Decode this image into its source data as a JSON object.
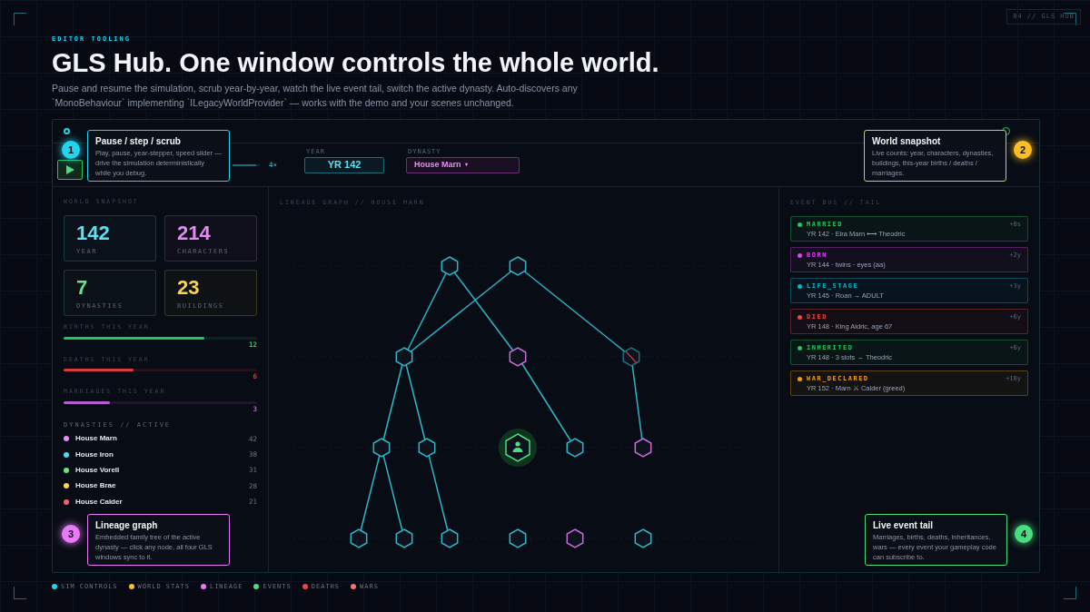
{
  "page_tag": "04 // GLS HUB",
  "eyebrow": "EDITOR TOOLING",
  "headline": "GLS Hub. One window controls the whole world.",
  "intro": "Pause and resume the simulation, scrub year-by-year, watch the live event tail, switch the active dynasty. Auto-discovers any `MonoBehaviour` implementing `ILegacyWorldProvider` — works with the demo and your scenes unchanged.",
  "toolbar": {
    "speed": {
      "reading": "4×",
      "level": 0.85
    },
    "year_label": "YEAR",
    "year": "YR 142",
    "dynasty_label": "DYNASTY",
    "dynasty": "House Marn",
    "caret": "▾"
  },
  "snapshot": {
    "title": "WORLD SNAPSHOT",
    "stats": [
      {
        "value": "142",
        "label": "YEAR",
        "color": "#5ce1f2"
      },
      {
        "value": "214",
        "label": "CHARACTERS",
        "color": "#e68af0"
      },
      {
        "value": "7",
        "label": "DYNASTIES",
        "color": "#6ee08a"
      },
      {
        "value": "23",
        "label": "BUILDINGS",
        "color": "#fcd34d"
      }
    ],
    "bars": [
      {
        "label": "BIRTHS THIS YEAR",
        "level": 0.73,
        "reading": "12",
        "color": "#22c55e"
      },
      {
        "label": "DEATHS THIS YEAR",
        "level": 0.36,
        "reading": "6",
        "color": "#dc3b3b"
      },
      {
        "label": "MARRIAGES THIS YEAR",
        "level": 0.24,
        "reading": "3",
        "color": "#b55ad0"
      }
    ],
    "dynasties_title": "DYNASTIES // ACTIVE",
    "dynasties": [
      {
        "name": "House Marn",
        "count": "42",
        "color": "#e88ef0"
      },
      {
        "name": "House Iron",
        "count": "38",
        "color": "#4fd8f0"
      },
      {
        "name": "House Vorell",
        "count": "31",
        "color": "#6ee08a"
      },
      {
        "name": "House Brae",
        "count": "28",
        "color": "#fcd34d"
      },
      {
        "name": "House Calder",
        "count": "21",
        "color": "#f06272"
      }
    ]
  },
  "lineage": {
    "title": "LINEAGE GRAPH // HOUSE MARN"
  },
  "events": {
    "title": "EVENT BUS // TAIL",
    "items": [
      {
        "type": "MARRIED",
        "text": "YR 142 · Eira Marn ⟷ Theodric",
        "age": "+0s",
        "color": "#22c55e"
      },
      {
        "type": "BORN",
        "text": "YR 144 · twins · eyes (aa)",
        "age": "+2y",
        "color": "#d946ef"
      },
      {
        "type": "LIFE_STAGE",
        "text": "YR 145 · Roan → ADULT",
        "age": "+3y",
        "color": "#06b6d4"
      },
      {
        "type": "DIED",
        "text": "YR 148 · King Aldric, age 67",
        "age": "+6y",
        "color": "#ef4444"
      },
      {
        "type": "INHERITED",
        "text": "YR 148 · 3 slots → Theodric",
        "age": "+6y",
        "color": "#22c55e"
      },
      {
        "type": "WAR_DECLARED",
        "text": "YR 152 · Marn ⚔ Calder (greed)",
        "age": "+10y",
        "color": "#f59e0b"
      }
    ]
  },
  "callouts": [
    {
      "number": "1",
      "title": "Pause / step / scrub",
      "text": "Play, pause, year-stepper, speed slider — drive the simulation deterministically while you debug.",
      "color": "#22d3ee"
    },
    {
      "number": "2",
      "title": "World snapshot",
      "text": "Live counts: year, characters, dynasties, buildings, this-year births / deaths / marriages.",
      "color": "#fbbf24"
    },
    {
      "number": "3",
      "title": "Lineage graph",
      "text": "Embedded family tree of the active dynasty — click any node, all four GLS windows sync to it.",
      "color": "#e879f9"
    },
    {
      "number": "4",
      "title": "Live event tail",
      "text": "Marriages, births, deaths, inheritances, wars — every event your gameplay code can subscribe to.",
      "color": "#4ade80"
    }
  ],
  "legend": [
    {
      "label": "SIM CONTROLS",
      "color": "#22d3ee"
    },
    {
      "label": "WORLD STATS",
      "color": "#fbbf24"
    },
    {
      "label": "LINEAGE",
      "color": "#e879f9"
    },
    {
      "label": "EVENTS",
      "color": "#4ade80"
    },
    {
      "label": "DEATHS",
      "color": "#ef4444"
    },
    {
      "label": "WARS",
      "color": "#f87171"
    }
  ]
}
